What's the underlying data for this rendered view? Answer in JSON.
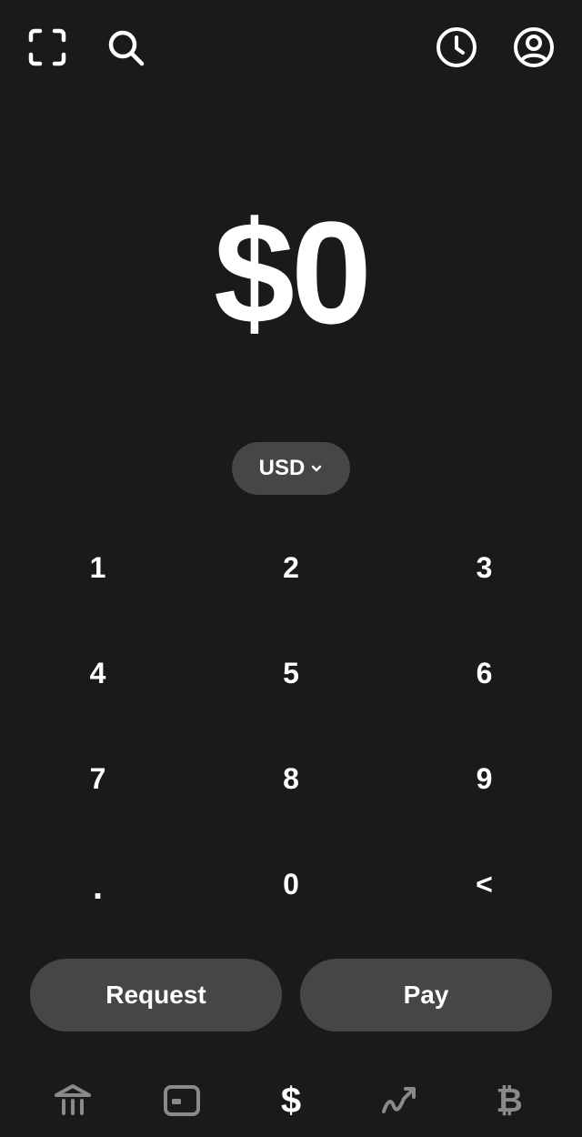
{
  "top_bar": {
    "icons": [
      "scan-icon",
      "search-icon",
      "activity-clock-icon",
      "profile-icon"
    ]
  },
  "amount": {
    "display": "$0"
  },
  "currency": {
    "selected": "USD"
  },
  "keypad": {
    "keys": [
      "1",
      "2",
      "3",
      "4",
      "5",
      "6",
      "7",
      "8",
      "9",
      ".",
      "0",
      "<"
    ]
  },
  "actions": {
    "request_label": "Request",
    "pay_label": "Pay"
  },
  "bottom_nav": {
    "items": [
      {
        "icon": "bank-icon",
        "active": false
      },
      {
        "icon": "card-icon",
        "active": false
      },
      {
        "icon": "dollar-sign-icon",
        "glyph": "$",
        "active": true
      },
      {
        "icon": "investing-trend-icon",
        "active": false
      },
      {
        "icon": "bitcoin-icon",
        "glyph": "₿",
        "active": false
      }
    ]
  },
  "colors": {
    "background": "#1a1a1a",
    "button": "#464646",
    "text": "#ffffff",
    "nav_inactive": "#8a8a8a",
    "nav_active": "#ffffff"
  }
}
